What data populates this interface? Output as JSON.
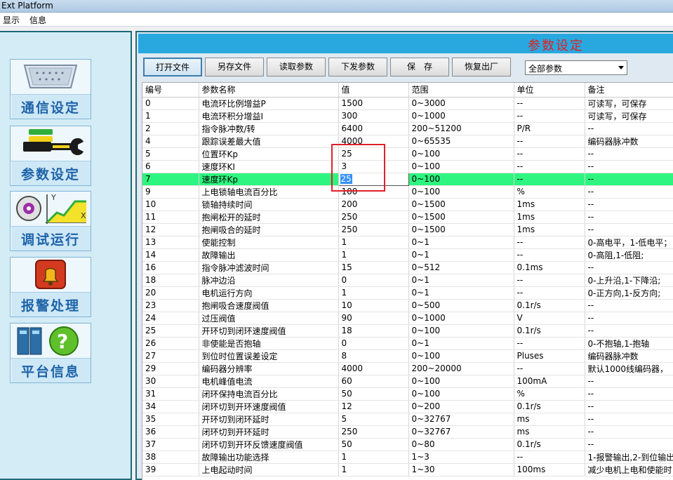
{
  "window": {
    "title": "Ext Platform"
  },
  "menu": {
    "items": [
      "显示",
      "信息"
    ]
  },
  "sidebar": {
    "items": [
      {
        "label": "通信设定",
        "icon": "serial-port-icon"
      },
      {
        "label": "参数设定",
        "icon": "wrench-icon"
      },
      {
        "label": "调试运行",
        "icon": "motion-graph-icon"
      },
      {
        "label": "报警处理",
        "icon": "alarm-bell-icon"
      },
      {
        "label": "平台信息",
        "icon": "help-device-icon"
      }
    ]
  },
  "main": {
    "header_title": "参数设定",
    "toolbar": {
      "open_file": "打开文件",
      "save_as": "另存文件",
      "read_params": "读取参数",
      "send_params": "下发参数",
      "save": "保　存",
      "restore_factory": "恢复出厂"
    },
    "filter": {
      "selected": "全部参数"
    },
    "table": {
      "columns": [
        "编号",
        "参数名称",
        "值",
        "范围",
        "单位",
        "备注"
      ],
      "selected_row_index": 6,
      "editing_value": "25",
      "rows": [
        [
          "0",
          "电流环比例增益P",
          "1500",
          "0~3000",
          "--",
          "可读写，可保存"
        ],
        [
          "1",
          "电流环积分增益I",
          "300",
          "0~1000",
          "--",
          "可读写，可保存"
        ],
        [
          "2",
          "指令脉冲数/转",
          "6400",
          "200~51200",
          "P/R",
          "--"
        ],
        [
          "4",
          "跟踪误差最大值",
          "4000",
          "0~65535",
          "--",
          "编码器脉冲数"
        ],
        [
          "5",
          "位置环Kp",
          "25",
          "0~100",
          "--",
          "--"
        ],
        [
          "6",
          "速度环KI",
          "3",
          "0~100",
          "--",
          "--"
        ],
        [
          "7",
          "速度环Kp",
          "25",
          "0~100",
          "--",
          "--"
        ],
        [
          "9",
          "上电锁轴电流百分比",
          "100",
          "0~100",
          "%",
          "--"
        ],
        [
          "10",
          "锁轴持续时间",
          "200",
          "0~1500",
          "1ms",
          "--"
        ],
        [
          "11",
          "抱闸松开的延时",
          "250",
          "0~1500",
          "1ms",
          "--"
        ],
        [
          "12",
          "抱闸吸合的延时",
          "250",
          "0~1500",
          "1ms",
          "--"
        ],
        [
          "13",
          "使能控制",
          "1",
          "0~1",
          "--",
          "0-高电平，1-低电平；"
        ],
        [
          "14",
          "故障输出",
          "1",
          "0~1",
          "--",
          "0-高阻,1-低阻;"
        ],
        [
          "16",
          "指令脉冲滤波时间",
          "15",
          "0~512",
          "0.1ms",
          "--"
        ],
        [
          "18",
          "脉冲边沿",
          "0",
          "0~1",
          "--",
          "0-上升沿,1-下降沿;"
        ],
        [
          "20",
          "电机运行方向",
          "1",
          "0~1",
          "--",
          "0-正方向,1-反方向;"
        ],
        [
          "23",
          "抱闸吸合速度阀值",
          "10",
          "0~500",
          "0.1r/s",
          "--"
        ],
        [
          "24",
          "过压阀值",
          "90",
          "0~1000",
          "V",
          "--"
        ],
        [
          "25",
          "开环切到闭环速度阀值",
          "18",
          "0~100",
          "0.1r/s",
          "--"
        ],
        [
          "26",
          "非使能是否抱轴",
          "0",
          "0~1",
          "--",
          "0-不抱轴,1-抱轴"
        ],
        [
          "27",
          "到位时位置误差设定",
          "8",
          "0~100",
          "Pluses",
          "编码器脉冲数"
        ],
        [
          "29",
          "编码器分辨率",
          "4000",
          "200~20000",
          "--",
          "默认1000线编码器，"
        ],
        [
          "30",
          "电机峰值电流",
          "60",
          "0~100",
          "100mA",
          "--"
        ],
        [
          "31",
          "闭环保持电流百分比",
          "50",
          "0~100",
          "%",
          "--"
        ],
        [
          "34",
          "闭环切到开环速度阀值",
          "12",
          "0~200",
          "0.1r/s",
          "--"
        ],
        [
          "35",
          "开环切到闭环延时",
          "5",
          "0~32767",
          "ms",
          "--"
        ],
        [
          "36",
          "闭环切到开环延时",
          "250",
          "0~32767",
          "ms",
          "--"
        ],
        [
          "37",
          "闭环切到开环反馈速度阀值",
          "50",
          "0~80",
          "0.1r/s",
          "--"
        ],
        [
          "38",
          "故障输出功能选择",
          "1",
          "1~3",
          "--",
          "1-报警输出,2-到位输出"
        ],
        [
          "39",
          "上电起动时间",
          "1",
          "1~30",
          "100ms",
          "减少电机上电和使能时"
        ]
      ]
    }
  },
  "colors": {
    "header_bg": "#29a8e0",
    "header_text": "#e02020",
    "selected_row": "#2ef57f",
    "nav_label": "#1e63a8",
    "annotation": "#e0202a"
  }
}
